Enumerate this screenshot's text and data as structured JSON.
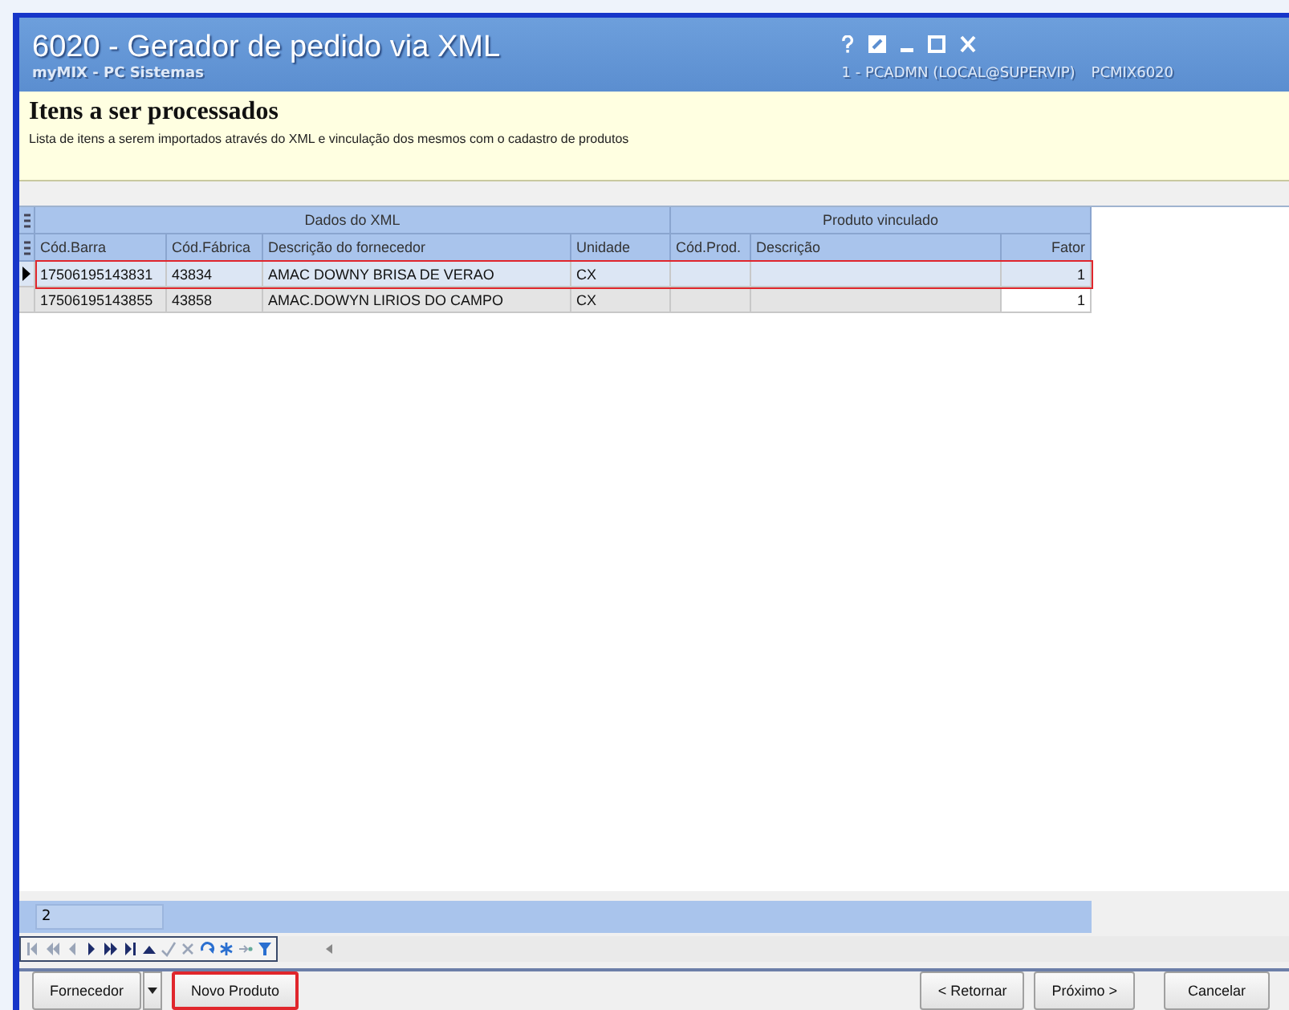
{
  "window": {
    "title": "6020 - Gerador de pedido via XML",
    "subtitle": "myMIX - PC Sistemas",
    "session": "1 - PCADMN (LOCAL@SUPERVIP)",
    "routine": "PCMIX6020"
  },
  "header": {
    "title": "Itens a ser processados",
    "description": "Lista de itens a serem importados através do XML e vinculação dos mesmos com o cadastro de produtos"
  },
  "table": {
    "groups": [
      {
        "label": "Dados do XML"
      },
      {
        "label": "Produto vinculado"
      }
    ],
    "columns": [
      {
        "label": "Cód.Barra"
      },
      {
        "label": "Cód.Fábrica"
      },
      {
        "label": "Descrição do fornecedor"
      },
      {
        "label": "Unidade"
      },
      {
        "label": "Cód.Prod."
      },
      {
        "label": "Descrição"
      },
      {
        "label": "Fator"
      }
    ],
    "rows": [
      {
        "selected": true,
        "highlighted": true,
        "cells": [
          "17506195143831",
          "43834",
          "AMAC DOWNY BRISA DE VERAO",
          "CX",
          "",
          "",
          "1"
        ]
      },
      {
        "selected": false,
        "highlighted": false,
        "cells": [
          "17506195143855",
          "43858",
          "AMAC.DOWYN LIRIOS DO CAMPO",
          "CX",
          "",
          "",
          "1"
        ]
      }
    ],
    "count": "2"
  },
  "navigator": [
    {
      "kind": "first",
      "disabled": true
    },
    {
      "kind": "prev-page",
      "disabled": true
    },
    {
      "kind": "prev",
      "disabled": true
    },
    {
      "kind": "next",
      "disabled": false
    },
    {
      "kind": "next-page",
      "disabled": false
    },
    {
      "kind": "last",
      "disabled": false
    },
    {
      "kind": "insert",
      "disabled": false
    },
    {
      "kind": "post",
      "disabled": true
    },
    {
      "kind": "cancel",
      "disabled": true
    },
    {
      "kind": "refresh",
      "disabled": false
    },
    {
      "kind": "bookmark",
      "disabled": false
    },
    {
      "kind": "goto",
      "disabled": true
    },
    {
      "kind": "filter",
      "disabled": false
    }
  ],
  "buttons_left": [
    {
      "label": "Fornecedor",
      "kind": "split",
      "highlighted": false
    },
    {
      "label": "Novo Produto",
      "kind": "plain",
      "highlighted": true
    }
  ],
  "buttons_right": [
    {
      "label": "< Retornar"
    },
    {
      "label": "Próximo >"
    },
    {
      "label": "Cancelar"
    }
  ]
}
